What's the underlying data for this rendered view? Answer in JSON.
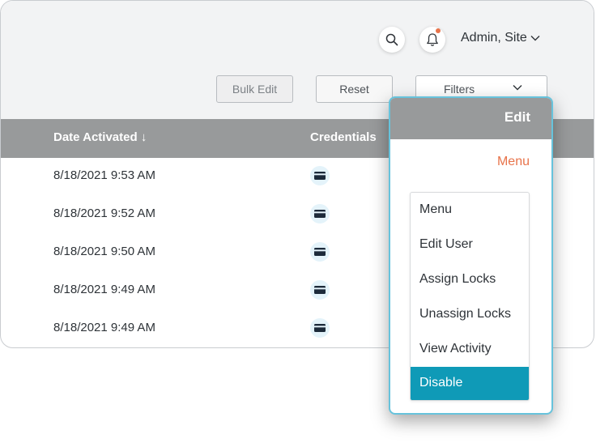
{
  "header": {
    "user_label": "Admin, Site",
    "icons": {
      "search": "search-icon",
      "notifications": "bell-icon",
      "user_dropdown": "chevron-down-icon"
    },
    "notification_dot_color": "#e8734a"
  },
  "toolbar": {
    "bulk_edit_label": "Bulk Edit",
    "reset_label": "Reset",
    "filters_label": "Filters"
  },
  "table": {
    "columns": {
      "date_activated": "Date Activated ↓",
      "credentials": "Credentials"
    },
    "rows": [
      {
        "date": "8/18/2021 9:53 AM",
        "credential_icon": "card-icon"
      },
      {
        "date": "8/18/2021 9:52 AM",
        "credential_icon": "card-icon"
      },
      {
        "date": "8/18/2021 9:50 AM",
        "credential_icon": "card-icon"
      },
      {
        "date": "8/18/2021 9:49 AM",
        "credential_icon": "card-icon"
      },
      {
        "date": "8/18/2021 9:49 AM",
        "credential_icon": "card-icon"
      }
    ]
  },
  "popup": {
    "title": "Edit",
    "menu_link": "Menu",
    "items": [
      "Menu",
      "Edit User",
      "Assign Locks",
      "Unassign Locks",
      "View Activity",
      "Disable"
    ],
    "selected_item": "Disable"
  },
  "colors": {
    "header_gray": "#989a9b",
    "accent_orange": "#e8734a",
    "selected_teal": "#0f9ab7",
    "popup_border": "#67c3dc"
  }
}
